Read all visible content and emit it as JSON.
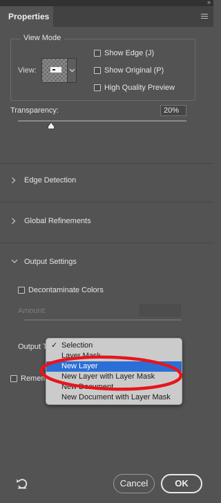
{
  "panel": {
    "tab_label": "Properties"
  },
  "view_mode": {
    "legend": "View Mode",
    "view_label": "View:",
    "checkboxes": [
      {
        "label": "Show Edge (J)",
        "checked": false
      },
      {
        "label": "Show Original (P)",
        "checked": false
      },
      {
        "label": "High Quality Preview",
        "checked": false
      }
    ]
  },
  "transparency": {
    "label": "Transparency:",
    "value_text": "20%",
    "value": 20
  },
  "sections": {
    "edge_detection": "Edge Detection",
    "global_refinements": "Global Refinements",
    "output_settings": "Output Settings"
  },
  "output": {
    "decontaminate_label": "Decontaminate Colors",
    "decontaminate_checked": false,
    "amount_label": "Amount:",
    "output_to_label": "Output To:",
    "remember_label": "Remember Settings",
    "dropdown_options": [
      "Selection",
      "Layer Mask",
      "New Layer",
      "New Layer with Layer Mask",
      "New Document",
      "New Document with Layer Mask"
    ],
    "checked_option": "Selection",
    "highlighted_option": "New Layer"
  },
  "buttons": {
    "cancel": "Cancel",
    "ok": "OK"
  },
  "colors": {
    "panel_bg": "#535353",
    "highlight": "#2a6fd6",
    "annotation": "#e8151b"
  }
}
